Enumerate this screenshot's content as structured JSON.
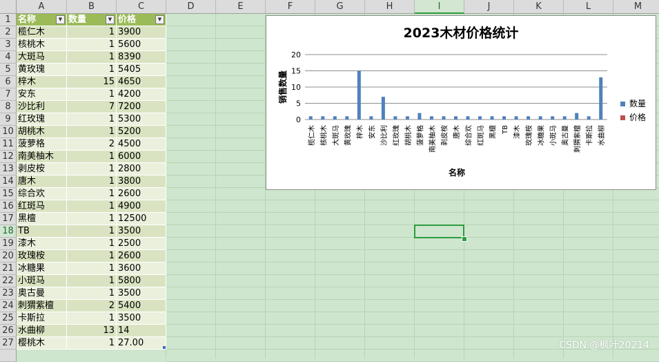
{
  "columns": [
    "A",
    "B",
    "C",
    "D",
    "E",
    "F",
    "G",
    "H",
    "I",
    "J",
    "K",
    "L",
    "M"
  ],
  "selected_column": "I",
  "selected_row": 18,
  "table": {
    "headers": [
      "名称",
      "数量",
      "价格"
    ],
    "rows": [
      [
        "榄仁木",
        "1",
        "3900"
      ],
      [
        "核桃木",
        "1",
        "5600"
      ],
      [
        "大斑马",
        "1",
        "8390"
      ],
      [
        "黄玫瑰",
        "1",
        "5405"
      ],
      [
        "梓木",
        "15",
        "4650"
      ],
      [
        "安东",
        "1",
        "4200"
      ],
      [
        "沙比利",
        "7",
        "7200"
      ],
      [
        "红玫瑰",
        "1",
        "5300"
      ],
      [
        "胡桃木",
        "1",
        "5200"
      ],
      [
        "菠萝格",
        "2",
        "4500"
      ],
      [
        "南美柚木",
        "1",
        "6000"
      ],
      [
        "剥皮桉",
        "1",
        "2800"
      ],
      [
        "唐木",
        "1",
        "3800"
      ],
      [
        "综合欢",
        "1",
        "2600"
      ],
      [
        "红斑马",
        "1",
        "4900"
      ],
      [
        "黑檀",
        "1",
        "12500"
      ],
      [
        "TB",
        "1",
        "3500"
      ],
      [
        "漆木",
        "1",
        "2500"
      ],
      [
        "玫瑰桉",
        "1",
        "2600"
      ],
      [
        "冰糖果",
        "1",
        "3600"
      ],
      [
        "小斑马",
        "1",
        "5800"
      ],
      [
        "奥古曼",
        "1",
        "3500"
      ],
      [
        "刺猬紫檀",
        "2",
        "5400"
      ],
      [
        "卡斯拉",
        "1",
        "3500"
      ],
      [
        "水曲柳",
        "13",
        "14"
      ],
      [
        "樱桃木",
        "1",
        "27.00"
      ]
    ]
  },
  "chart_data": {
    "type": "bar",
    "title": "2023木材价格统计",
    "xlabel": "名称",
    "ylabel": "销售数量",
    "ylim": [
      0,
      20
    ],
    "yticks": [
      "0",
      "5",
      "10",
      "15",
      "20"
    ],
    "categories": [
      "榄仁木",
      "核桃木",
      "大斑马",
      "黄玫瑰",
      "梓木",
      "安东",
      "沙比利",
      "红玫瑰",
      "胡桃木",
      "菠萝格",
      "南美柚木",
      "剥皮桉",
      "唐木",
      "综合欢",
      "红斑马",
      "黑檀",
      "TB",
      "漆木",
      "玫瑰桉",
      "冰糖果",
      "小斑马",
      "奥古曼",
      "刺猬紫檀",
      "卡斯拉",
      "水曲柳"
    ],
    "series": [
      {
        "name": "数量",
        "color": "#4f81bd",
        "values": [
          1,
          1,
          1,
          1,
          15,
          1,
          7,
          1,
          1,
          2,
          1,
          1,
          1,
          1,
          1,
          1,
          1,
          1,
          1,
          1,
          1,
          1,
          2,
          1,
          13
        ]
      },
      {
        "name": "价格",
        "color": "#c0504d",
        "values": [
          3900,
          5600,
          8390,
          5405,
          4650,
          4200,
          7200,
          5300,
          5200,
          4500,
          6000,
          2800,
          3800,
          2600,
          4900,
          12500,
          3500,
          2500,
          2600,
          3600,
          5800,
          3500,
          5400,
          3500,
          14
        ]
      }
    ],
    "legend": "right",
    "grid": true
  },
  "watermark": "CSDN @枫叶20214"
}
